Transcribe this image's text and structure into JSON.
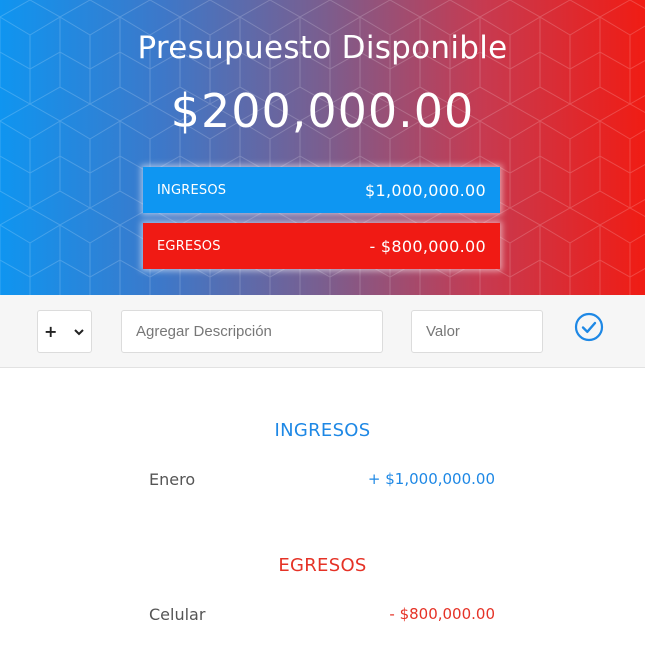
{
  "header": {
    "title": "Presupuesto Disponible",
    "available_amount": "$200,000.00",
    "income_summary": {
      "label": "INGRESOS",
      "value": "$1,000,000.00",
      "color": "#0e96f2"
    },
    "expense_summary": {
      "label": "EGRESOS",
      "value": "- $800,000.00",
      "color": "#f01a14"
    },
    "gradient_colors": [
      "#0f95f0",
      "#f01c14"
    ]
  },
  "add_form": {
    "type_selected": "+",
    "description_placeholder": "Agregar Descripción",
    "value_placeholder": "Valor",
    "submit_icon": "check-circle-icon",
    "accent": "#1e88e5"
  },
  "lists": {
    "income": {
      "title": "INGRESOS",
      "items": [
        {
          "description": "Enero",
          "value": "+ $1,000,000.00"
        }
      ]
    },
    "expense": {
      "title": "EGRESOS",
      "items": [
        {
          "description": "Celular",
          "value": "- $800,000.00"
        }
      ]
    }
  }
}
